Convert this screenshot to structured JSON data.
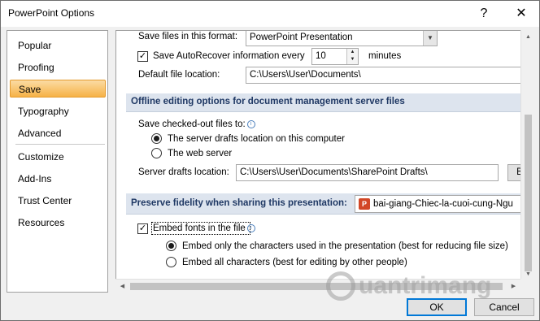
{
  "window": {
    "title": "PowerPoint Options",
    "help_glyph": "?",
    "close_glyph": "✕"
  },
  "nav": {
    "items": [
      {
        "label": "Popular"
      },
      {
        "label": "Proofing"
      },
      {
        "label": "Save",
        "selected": true
      },
      {
        "label": "Typography"
      },
      {
        "label": "Advanced"
      },
      {
        "label": "Customize"
      },
      {
        "label": "Add-Ins"
      },
      {
        "label": "Trust Center"
      },
      {
        "label": "Resources"
      }
    ]
  },
  "save": {
    "format_label": "Save files in this format:",
    "format_value": "PowerPoint Presentation",
    "autorecover_label": "Save AutoRecover information every",
    "autorecover_checked": true,
    "autorecover_value": "10",
    "autorecover_unit": "minutes",
    "default_location_label": "Default file location:",
    "default_location_value": "C:\\Users\\User\\Documents\\"
  },
  "offline": {
    "section_title": "Offline editing options for document management server files",
    "save_checked_out_label": "Save checked-out files to:",
    "option_server_drafts": "The server drafts location on this computer",
    "option_web_server": "The web server",
    "server_drafts_label": "Server drafts location:",
    "server_drafts_value": "C:\\Users\\User\\Documents\\SharePoint Drafts\\",
    "browse_label": "B"
  },
  "fidelity": {
    "section_title": "Preserve fidelity when sharing this presentation:",
    "file_value": "bai-giang-Chiec-la-cuoi-cung-Ngu",
    "embed_fonts_label": "Embed fonts in the file",
    "embed_fonts_checked": true,
    "option_only_used": "Embed only the characters used in the presentation (best for reducing file size)",
    "option_all": "Embed all characters (best for editing by other people)"
  },
  "buttons": {
    "ok": "OK",
    "cancel": "Cancel"
  },
  "watermark": {
    "text": "uantrimang"
  }
}
